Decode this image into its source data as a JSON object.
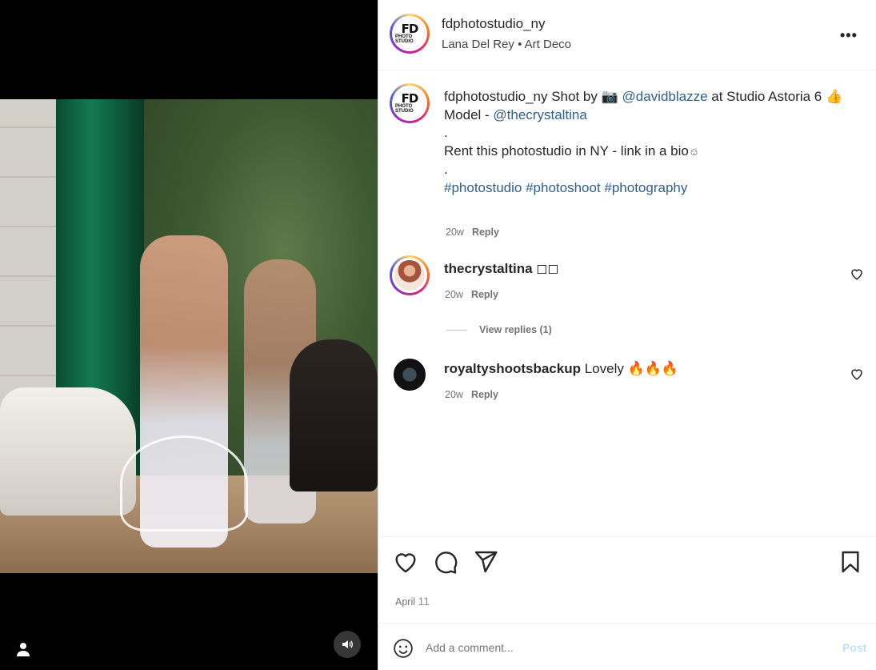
{
  "post": {
    "username": "fdphotostudio_ny",
    "audio": "Lana Del Rey",
    "separator": "•",
    "track": "Art Deco",
    "logo_big": "FD",
    "logo_small": "PHOTO STUDIO"
  },
  "caption": {
    "username": "fdphotostudio_ny",
    "text1": " Shot by ",
    "camera_emoji": "📷",
    "mention1": "@davidblazze",
    "text2": " at Studio Astoria 6 ",
    "thumbs_emoji": "👍",
    "model_label": "Model - ",
    "mention2": "@thecrystaltina",
    "dot1": ".",
    "rent_text": "Rent this photostudio in NY - link in a bio",
    "smile": "☺",
    "dot2": ".",
    "hashtags": "#photostudio #photoshoot #photography",
    "time": "20w",
    "reply": "Reply"
  },
  "comments": [
    {
      "username": "thecrystaltina",
      "text": " ◻◻",
      "time": "20w",
      "reply": "Reply",
      "view_replies": "View replies (1)"
    },
    {
      "username": "royaltyshootsbackup",
      "text": " Lovely 🔥🔥🔥",
      "time": "20w",
      "reply": "Reply"
    }
  ],
  "footer": {
    "date_month": "April",
    "date_day": "11",
    "add_comment_placeholder": "Add a comment...",
    "post_label": "Post"
  },
  "colors": {
    "link": "#2f5f8a",
    "post_disabled": "#c0dffd"
  }
}
